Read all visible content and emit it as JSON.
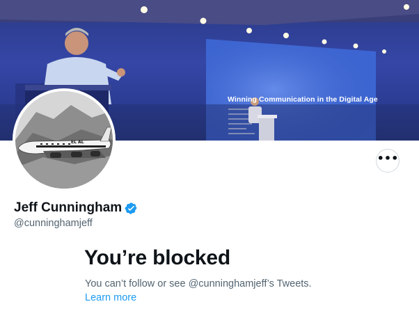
{
  "banner": {
    "slide_title": "Winning Communication in the Digital Age"
  },
  "profile": {
    "display_name": "Jeff Cunningham",
    "handle": "@cunninghamjeff",
    "verified": true,
    "avatar_plane_text": "EL AL"
  },
  "actions": {
    "more_label": "•••"
  },
  "blocked": {
    "title": "You’re blocked",
    "description": "You can’t follow or see @cunninghamjeff’s Tweets.",
    "learn_more": "Learn more"
  },
  "colors": {
    "accent": "#1d9bf0",
    "text_primary": "#0f1419",
    "text_secondary": "#536471",
    "border": "#cfd9de"
  }
}
